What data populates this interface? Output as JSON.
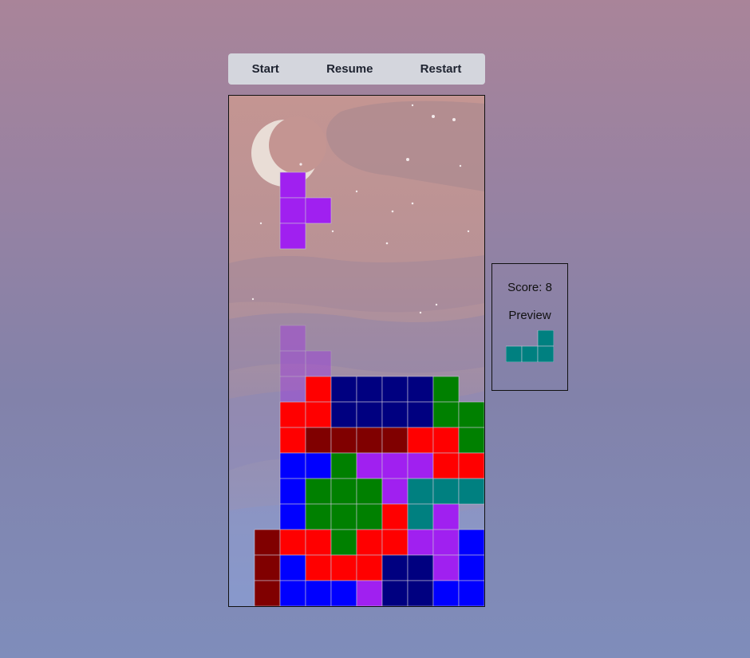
{
  "toolbar": {
    "start_label": "Start",
    "resume_label": "Resume",
    "restart_label": "Restart"
  },
  "panel": {
    "score_prefix": "Score:",
    "score": 8,
    "score_text": "Score: 8",
    "preview_label": "Preview"
  },
  "colors": {
    "P": "#a020f0",
    "R": "#ff0000",
    "D": "#800000",
    "N": "#000080",
    "B": "#0000ff",
    "G": "#008000",
    "T": "#008080"
  },
  "board": {
    "cols": 10,
    "rows": 20,
    "active_piece": {
      "color": "P",
      "cells": [
        [
          2,
          3
        ],
        [
          2,
          4
        ],
        [
          3,
          4
        ],
        [
          2,
          5
        ]
      ]
    },
    "ghost_piece": {
      "color": "P",
      "cells": [
        [
          2,
          9
        ],
        [
          2,
          10
        ],
        [
          3,
          10
        ],
        [
          2,
          11
        ]
      ]
    },
    "locked_rows": [
      "..........",
      "..........",
      "..........",
      "..........",
      "..........",
      "..........",
      "..........",
      "..........",
      "..........",
      "..........",
      "..........",
      "...RNNNNG.",
      "..RRNNNNGG",
      "..RDDDDRRG",
      "..BBGPPPRR",
      "..BGGGPTTT",
      "..BGGGRTP.",
      ".DRRGRRPPB",
      ".DBRRRNNPB",
      ".DBBBPNNBB"
    ]
  },
  "preview_piece": {
    "color": "T",
    "cols": 3,
    "rows": 2,
    "cells": [
      [
        2,
        0
      ],
      [
        0,
        1
      ],
      [
        1,
        1
      ],
      [
        2,
        1
      ]
    ]
  }
}
